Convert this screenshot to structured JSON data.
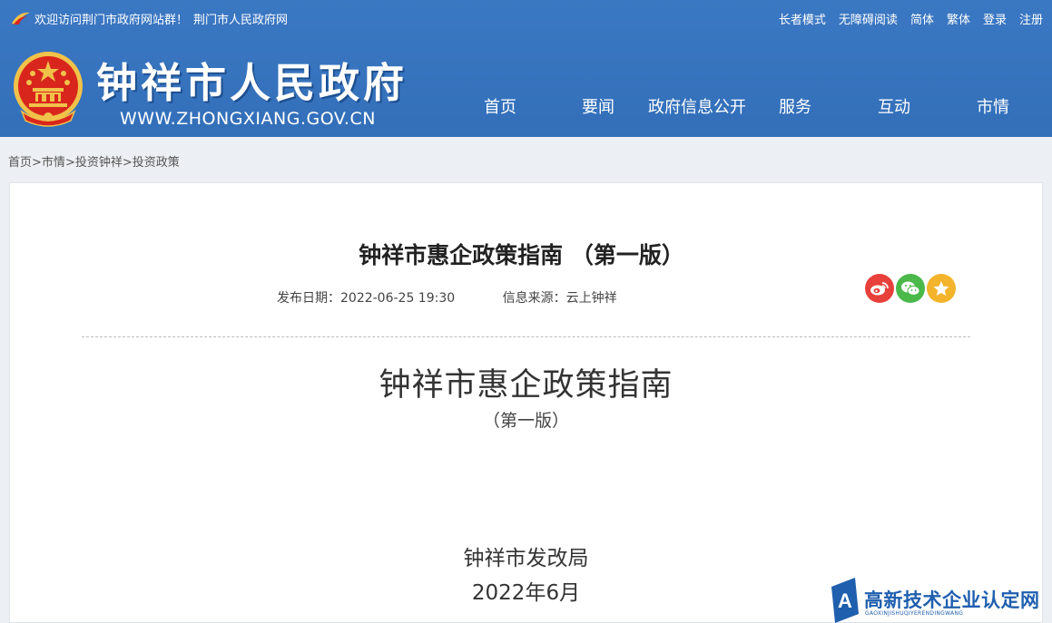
{
  "header": {
    "welcome_text": "欢迎访问荆门市政府网站群！",
    "welcome_link": "荆门市人民政府网",
    "top_links": {
      "elder_mode": "长者模式",
      "accessible": "无障碍阅读",
      "simplified": "简体",
      "traditional": "繁体",
      "login": "登录",
      "register": "注册"
    },
    "site_title": "钟祥市人民政府",
    "site_url": "WWW.ZHONGXIANG.GOV.CN",
    "nav": {
      "home": "首页",
      "news": "要闻",
      "gov_info": "政府信息公开",
      "services": "服务",
      "interaction": "互动",
      "city_info": "市情"
    }
  },
  "breadcrumb": {
    "items": [
      "首页",
      "市情",
      "投资钟祥",
      "投资政策"
    ],
    "separator": ">"
  },
  "article": {
    "title": "钟祥市惠企政策指南 （第一版）",
    "publish_label": "发布日期：",
    "publish_date": "2022-06-25 19:30",
    "source_label": "信息来源：",
    "source": "云上钟祥",
    "share_icons": [
      "weibo-icon",
      "wechat-icon",
      "favorite-star-icon"
    ]
  },
  "document": {
    "title": "钟祥市惠企政策指南",
    "edition": "（第一版）",
    "issuer": "钟祥市发改局",
    "date": "2022年6月"
  },
  "watermark": {
    "text": "高新技术企业认定网",
    "pinyin": "GAOXINJISHUQIYERENDINGWANG"
  },
  "colors": {
    "header_blue": "#3a76c0",
    "weibo_red": "#e8403a",
    "wechat_green": "#4bb84a",
    "fav_yellow": "#f3b42c",
    "emblem_red": "#d8261d",
    "emblem_gold": "#f1c24a"
  }
}
